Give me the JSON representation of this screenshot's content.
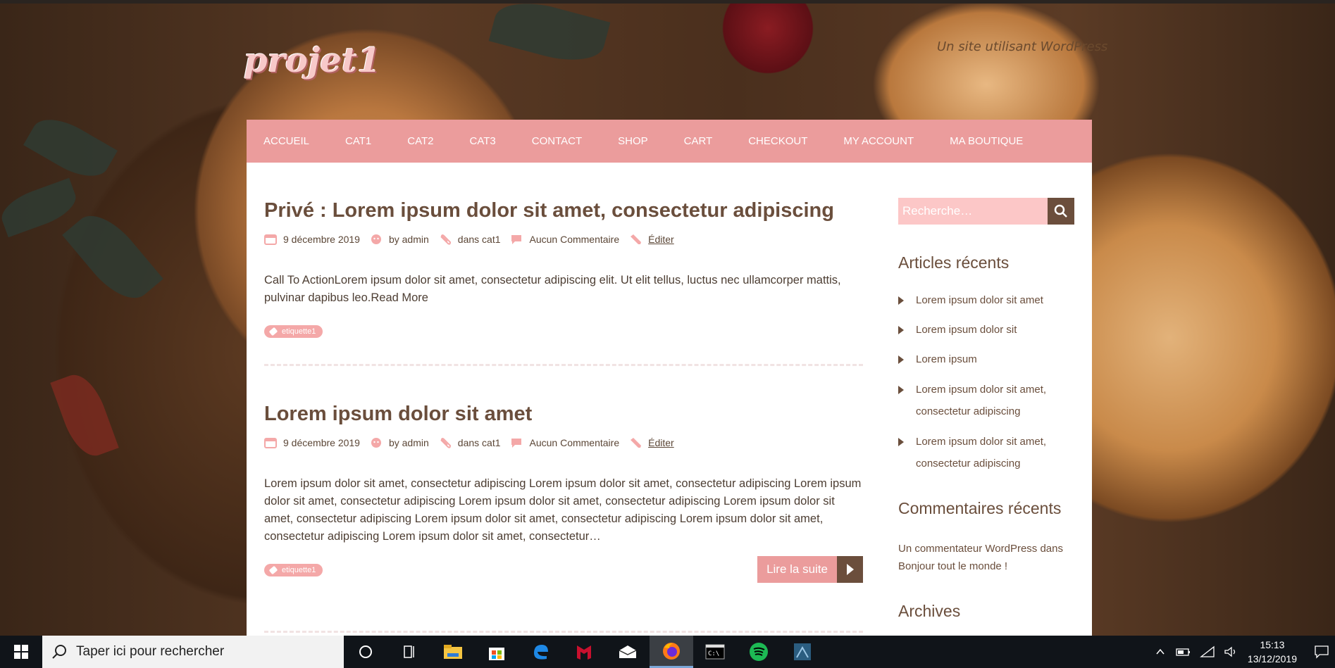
{
  "site": {
    "title": "projet1",
    "tagline": "Un site utilisant WordPress"
  },
  "nav": [
    "ACCUEIL",
    "CAT1",
    "CAT2",
    "CAT3",
    "CONTACT",
    "SHOP",
    "CART",
    "CHECKOUT",
    "MY ACCOUNT",
    "MA BOUTIQUE"
  ],
  "posts": [
    {
      "title": "Privé : Lorem ipsum dolor sit amet, consectetur adipiscing",
      "date": "9 décembre 2019",
      "author": "by admin",
      "category": "dans cat1",
      "comments": "Aucun Commentaire",
      "edit": "Éditer",
      "excerpt": "Call To ActionLorem ipsum dolor sit amet, consectetur adipiscing elit. Ut elit tellus, luctus nec ullamcorper mattis, pulvinar dapibus leo.Read More",
      "tag": "etiquette1"
    },
    {
      "title": "Lorem ipsum dolor sit amet",
      "date": "9 décembre 2019",
      "author": "by admin",
      "category": "dans cat1",
      "comments": "Aucun Commentaire",
      "edit": "Éditer",
      "excerpt": "Lorem ipsum dolor sit amet, consectetur adipiscing Lorem ipsum dolor sit amet, consectetur adipiscing Lorem ipsum dolor sit amet, consectetur adipiscing Lorem ipsum dolor sit amet, consectetur adipiscing Lorem ipsum dolor sit amet, consectetur adipiscing Lorem ipsum dolor sit amet, consectetur adipiscing Lorem ipsum dolor sit amet, consectetur adipiscing Lorem ipsum dolor sit amet, consectetur…",
      "tag": "etiquette1",
      "read_more": "Lire la suite"
    }
  ],
  "sidebar": {
    "search_placeholder": "Recherche…",
    "recent_title": "Articles récents",
    "recent": [
      "Lorem ipsum dolor sit amet",
      "Lorem ipsum dolor sit",
      "Lorem ipsum",
      "Lorem ipsum dolor sit amet, consectetur adipiscing",
      "Lorem ipsum dolor sit amet, consectetur adipiscing"
    ],
    "comments_title": "Commentaires récents",
    "comment_author": "Un commentateur WordPress",
    "comment_dans": "dans",
    "comment_post": "Bonjour tout le monde !",
    "archives_title": "Archives"
  },
  "taskbar": {
    "search_placeholder": "Taper ici pour rechercher",
    "time": "15:13",
    "date": "13/12/2019",
    "icons": [
      "cortana-icon",
      "task-view-icon",
      "file-explorer-icon",
      "store-icon",
      "edge-icon",
      "mcafee-icon",
      "mail-icon",
      "firefox-icon",
      "terminal-icon",
      "spotify-icon",
      "mysql-workbench-icon"
    ]
  },
  "colors": {
    "accent": "#eb9c9c",
    "brown": "#6b4e3c",
    "tag": "#f4a8a8"
  }
}
